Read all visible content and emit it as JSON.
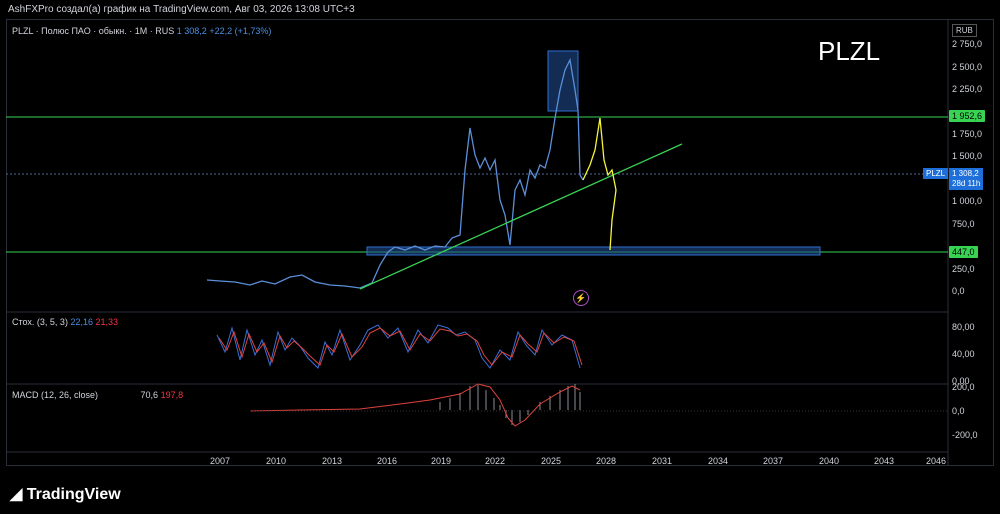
{
  "header": {
    "text": "AshFXPro создал(а) график на TradingView.com, Авг 03, 2026 13:08 UTC+3"
  },
  "legend": {
    "symbol": "PLZL · Полюс ПАО · обыкн. · 1M · RUS",
    "price": "1 308,2",
    "change": "+22,2 (+1,73%)"
  },
  "big_label": "PLZL",
  "currency": "RUB",
  "stoch": {
    "label": "Стох. (3, 5, 3)",
    "k": "22,16",
    "d": "21,33"
  },
  "macd": {
    "label": "MACD (12, 26, close)",
    "v1": "70,6",
    "v2": "197,8"
  },
  "price_axis": [
    "2 750,0",
    "2 500,0",
    "2 250,0",
    "1 750,0",
    "1 500,0",
    "1 000,0",
    "750,0",
    "250,0",
    "0,0"
  ],
  "stoch_axis": [
    "80,00",
    "40,00",
    "0,00"
  ],
  "macd_axis": [
    "200,0",
    "0,0",
    "-200,0"
  ],
  "levels": {
    "upper": "1 952,6",
    "lower": "447,0"
  },
  "current": {
    "symbol": "PLZL",
    "price": "1 308,2",
    "timer": "28d 11h"
  },
  "x_axis": [
    "2007",
    "2010",
    "2013",
    "2016",
    "2019",
    "2022",
    "2025",
    "2028",
    "2031",
    "2034",
    "2037",
    "2040",
    "2043",
    "2046"
  ],
  "colors": {
    "price_line": "#5b8fd9",
    "trend": "#39d353",
    "projection": "#f5f53b",
    "level": "#39d353",
    "zone": "#1e4a8c"
  },
  "watermark": "TradingView",
  "icon_bolt": "lightning-icon"
}
